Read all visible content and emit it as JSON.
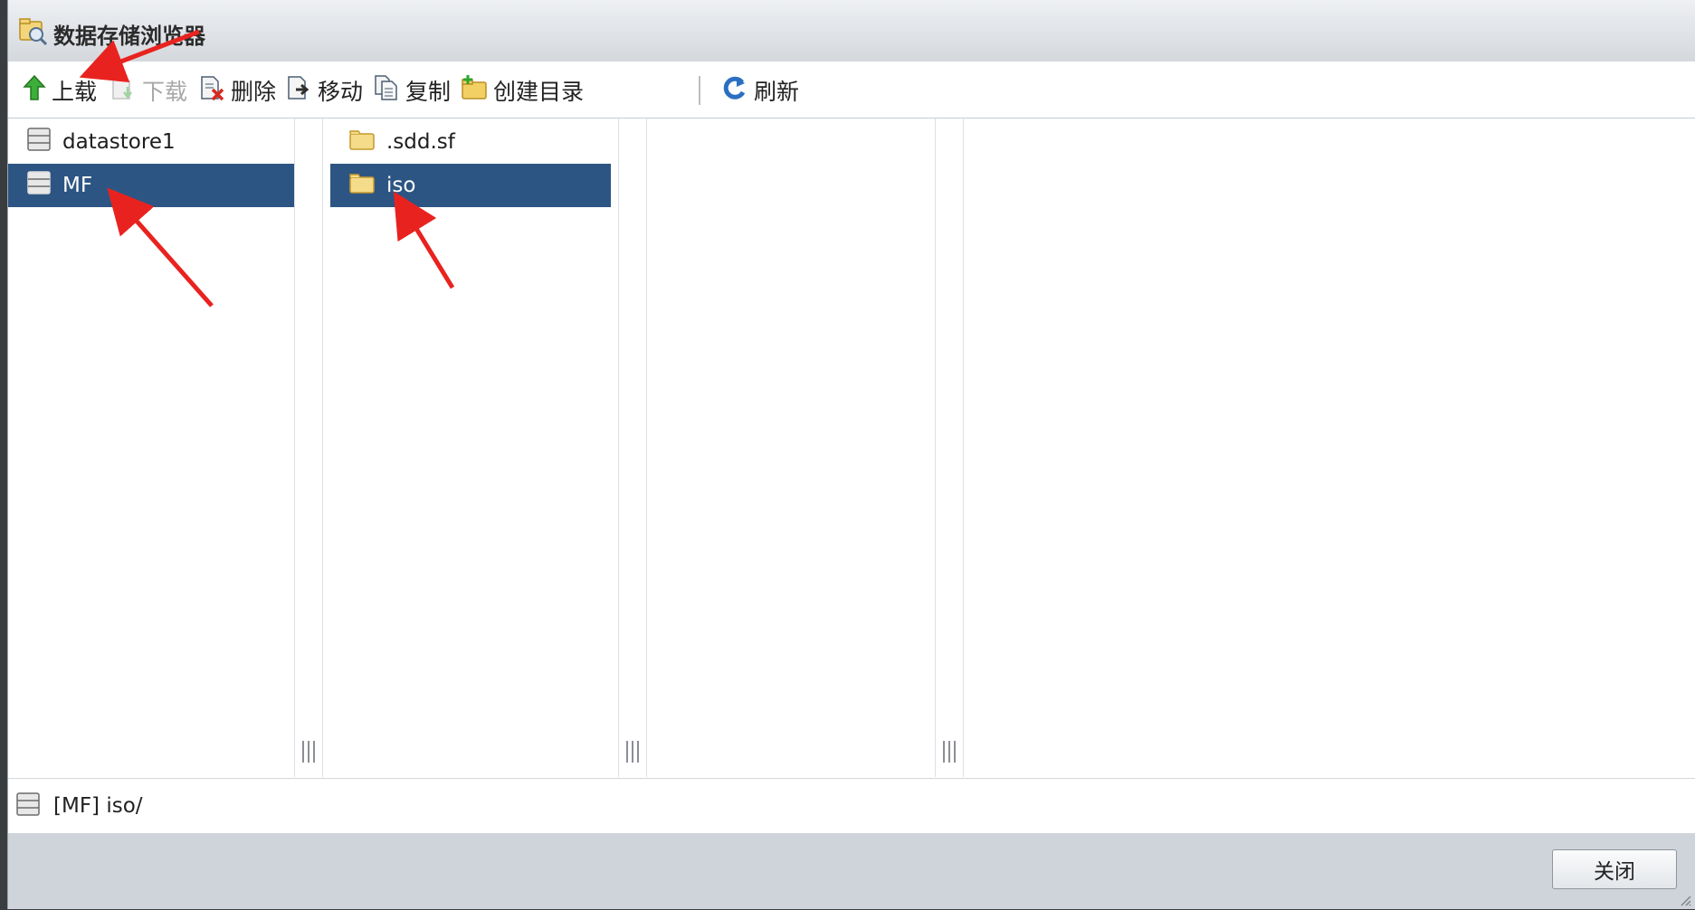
{
  "window": {
    "title": "数据存储浏览器",
    "title_icon": "datastore-browser-icon"
  },
  "toolbar": {
    "upload": {
      "label": "上载",
      "icon": "upload-arrow-icon",
      "enabled": true
    },
    "download": {
      "label": "下载",
      "icon": "download-icon",
      "enabled": false
    },
    "delete": {
      "label": "删除",
      "icon": "delete-icon",
      "enabled": true
    },
    "move": {
      "label": "移动",
      "icon": "move-icon",
      "enabled": true
    },
    "copy": {
      "label": "复制",
      "icon": "copy-icon",
      "enabled": true
    },
    "mkdir": {
      "label": "创建目录",
      "icon": "new-folder-icon",
      "enabled": true
    },
    "refresh": {
      "label": "刷新",
      "icon": "refresh-icon",
      "enabled": true
    }
  },
  "datastores": [
    {
      "name": "datastore1",
      "selected": false
    },
    {
      "name": "MF",
      "selected": true
    }
  ],
  "folders": [
    {
      "name": ".sdd.sf",
      "selected": false
    },
    {
      "name": "iso",
      "selected": true
    }
  ],
  "path": {
    "text": "[MF] iso/"
  },
  "footer": {
    "close_label": "关闭"
  },
  "colors": {
    "selection": "#2d5583",
    "footer_bg": "#cfd4db",
    "annotation_arrow": "#e8231f"
  }
}
